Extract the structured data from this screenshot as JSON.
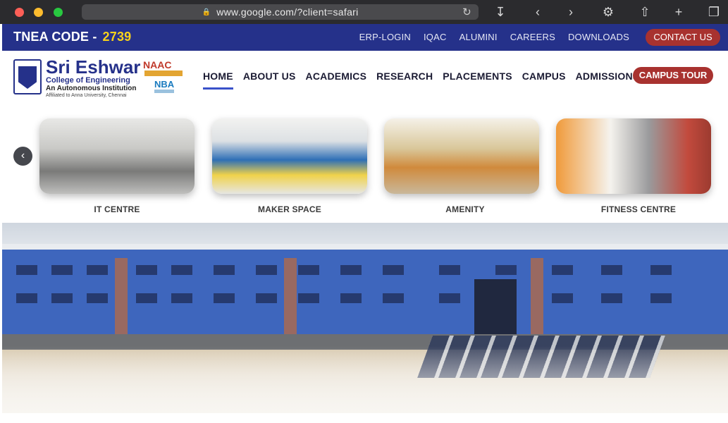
{
  "browser": {
    "url": "www.google.com/?client=safari",
    "icons": [
      "download-icon",
      "back-icon",
      "forward-icon",
      "settings-icon",
      "share-icon",
      "new-tab-icon",
      "tabs-icon"
    ]
  },
  "topbar": {
    "tnea_label": "TNEA CODE  -",
    "tnea_code": "2739",
    "links": [
      "ERP-LOGIN",
      "IQAC",
      "ALUMINI",
      "CAREERS",
      "DOWNLOADS"
    ],
    "contact": "CONTACT US"
  },
  "brand": {
    "name": "Sri Eshwar",
    "subtitle": "College of Engineering",
    "tagline": "An Autonomous Institution",
    "affiliation": "Affiliated to Anna University, Chennai",
    "accreditations": [
      "NAAC",
      "NBA"
    ]
  },
  "nav": {
    "items": [
      "HOME",
      "ABOUT US",
      "ACADEMICS",
      "RESEARCH",
      "PLACEMENTS",
      "CAMPUS",
      "ADMISSIONS"
    ],
    "active": "HOME",
    "cta": "CAMPUS TOUR"
  },
  "carousel": {
    "cards": [
      {
        "caption": "IT CENTRE"
      },
      {
        "caption": "MAKER SPACE"
      },
      {
        "caption": "AMENITY"
      },
      {
        "caption": "FITNESS CENTRE"
      }
    ]
  },
  "colors": {
    "brand_blue": "#25318a",
    "accent_yellow": "#f7d21b",
    "cta_red": "#a8322f",
    "active_underline": "#3a51c9"
  }
}
